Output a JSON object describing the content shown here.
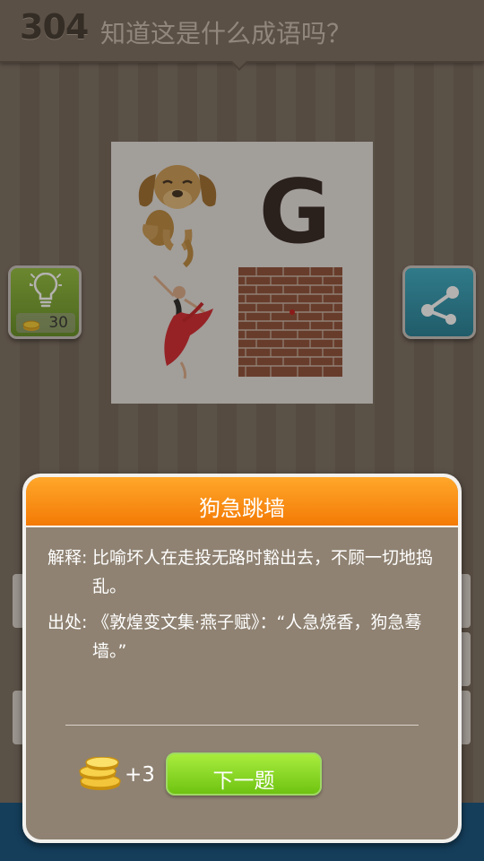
{
  "header": {
    "level": "304",
    "question": "知道这是什么成语吗？"
  },
  "puzzle": {
    "elements": [
      "dog",
      "letter-G",
      "dancer",
      "brick-wall"
    ],
    "letter": "G"
  },
  "hint": {
    "cost": "30"
  },
  "dialog": {
    "title": "狗急跳墙",
    "meaning_label": "解释:",
    "meaning_text": "比喻坏人在走投无路时豁出去，不顾一切地捣乱。",
    "source_label": "出处:",
    "source_text": "《敦煌变文集·燕子赋》：“人急烧香，狗急蓦墙。”",
    "reward": "+3",
    "next_label": "下一题"
  },
  "colors": {
    "accent": "#f37a05",
    "next": "#7fd21a",
    "hint": "#7fae2c",
    "share": "#2a95ae"
  }
}
